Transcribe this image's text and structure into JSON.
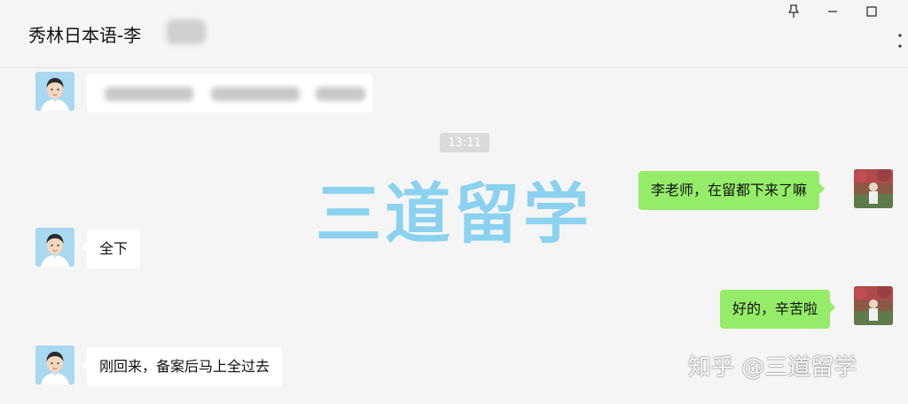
{
  "window": {
    "title": "秀林日本语-李",
    "buttons": {
      "pin": "⊼",
      "minimize": "—",
      "maximize": "☐",
      "close": "✕",
      "more": "⋮"
    }
  },
  "chat": {
    "timestamp": "13:11",
    "messages": [
      {
        "side": "right",
        "text": "李老师，在留都下来了嘛"
      },
      {
        "side": "left",
        "text": "全下"
      },
      {
        "side": "right",
        "text": "好的，辛苦啦"
      },
      {
        "side": "left",
        "text": "刚回来，备案后马上全过去"
      }
    ]
  },
  "overlay": {
    "watermark": "三道留学",
    "zhihu_watermark": "知乎 @三道留学"
  },
  "colors": {
    "background": "#f5f5f5",
    "bubble_self": "#95ec69",
    "bubble_other": "#ffffff",
    "watermark": "#7fcff0",
    "avatar_cartoon": "#a9d8f1"
  },
  "icons": {
    "pin": "pin-icon",
    "minimize": "minimize-icon",
    "maximize": "maximize-icon",
    "more": "more-icon",
    "avatar_other": "cartoon-avatar",
    "avatar_self": "photo-avatar"
  }
}
